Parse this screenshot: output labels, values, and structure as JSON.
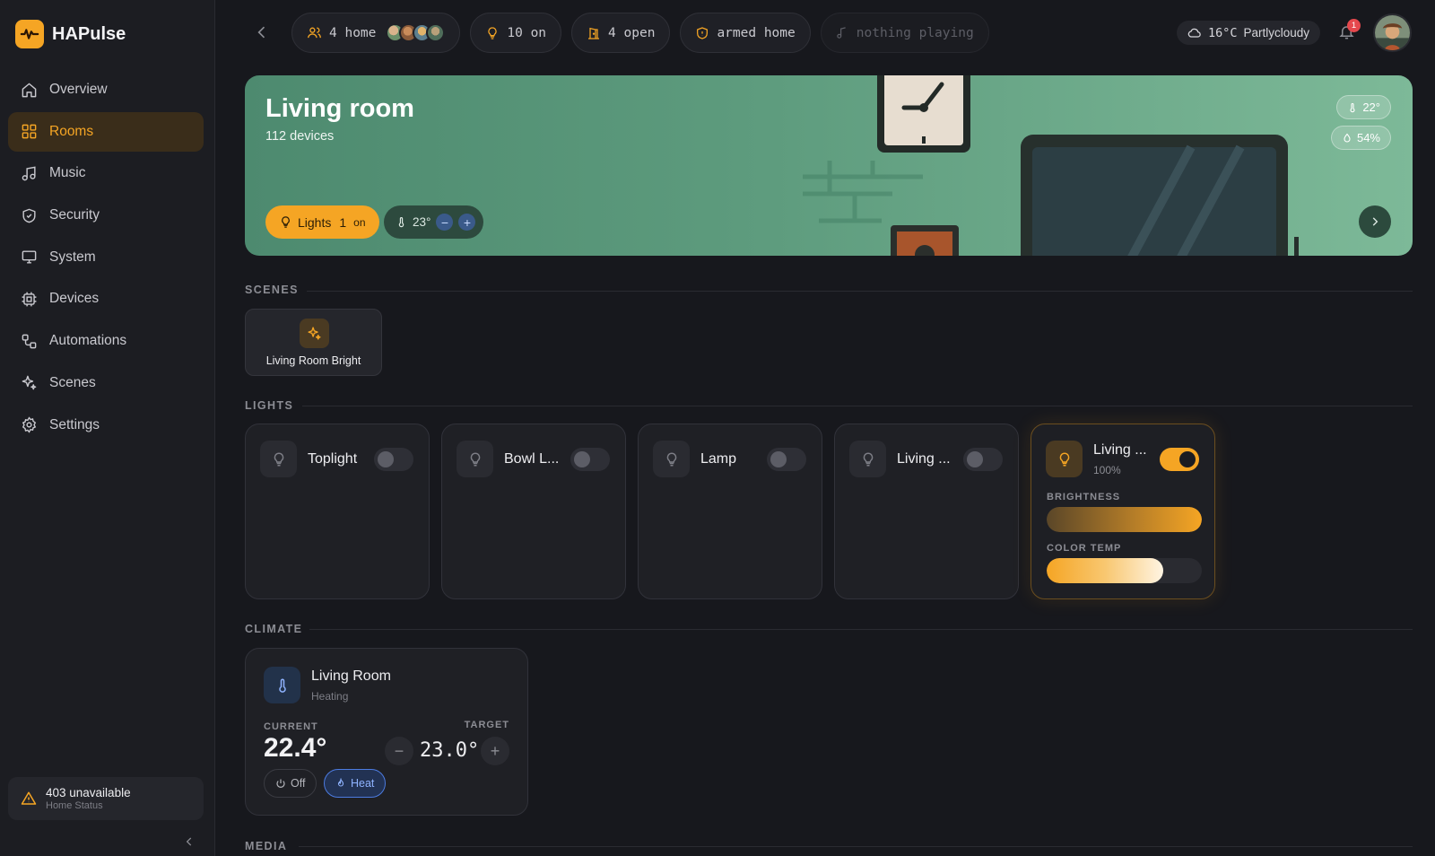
{
  "brand": {
    "name": "HAPulse"
  },
  "nav": [
    {
      "label": "Overview",
      "icon": "home-icon"
    },
    {
      "label": "Rooms",
      "icon": "grid-icon",
      "active": true
    },
    {
      "label": "Music",
      "icon": "music-note-icon"
    },
    {
      "label": "Security",
      "icon": "shield-icon"
    },
    {
      "label": "System",
      "icon": "monitor-icon"
    },
    {
      "label": "Devices",
      "icon": "chip-icon"
    },
    {
      "label": "Automations",
      "icon": "workflow-icon"
    },
    {
      "label": "Scenes",
      "icon": "sparkles-icon"
    },
    {
      "label": "Settings",
      "icon": "gear-icon"
    }
  ],
  "home_status": {
    "title": "403 unavailable",
    "subtitle": "Home Status"
  },
  "topbar": {
    "people": "4 home",
    "lights_on": "10 on",
    "open": "4 open",
    "alarm": "armed home",
    "media": "nothing playing",
    "weather": {
      "temp": "16°C",
      "condition": "Partlycloudy"
    },
    "notifications": "1"
  },
  "room": {
    "name": "Living room",
    "devices": "112 devices",
    "temperature": "22°",
    "humidity": "54%",
    "lights_label": "Lights",
    "lights_count": "1",
    "lights_state": "on",
    "target_temp": "23°"
  },
  "sections": {
    "scenes": "SCENES",
    "lights": "LIGHTS",
    "climate": "CLIMATE",
    "media": "MEDIA"
  },
  "scenes": [
    {
      "name": "Living Room Bright"
    }
  ],
  "lights": [
    {
      "name": "Toplight",
      "on": false
    },
    {
      "name": "Bowl L...",
      "on": false
    },
    {
      "name": "Lamp",
      "on": false
    },
    {
      "name": "Living ...",
      "on": false
    },
    {
      "name": "Living ...",
      "on": true,
      "brightness_text": "100%",
      "brightness": 1.0,
      "color_temp": 0.75
    }
  ],
  "light_labels": {
    "brightness": "BRIGHTNESS",
    "color_temp": "COLOR TEMP"
  },
  "climate": {
    "name": "Living Room",
    "mode": "Heating",
    "current_label": "CURRENT",
    "current": "22.4°",
    "target_label": "TARGET",
    "target": "23.0°",
    "off_label": "Off",
    "heat_label": "Heat"
  },
  "colors": {
    "accent": "#f5a524",
    "background": "#17181d",
    "heat": "#4c7be0"
  }
}
